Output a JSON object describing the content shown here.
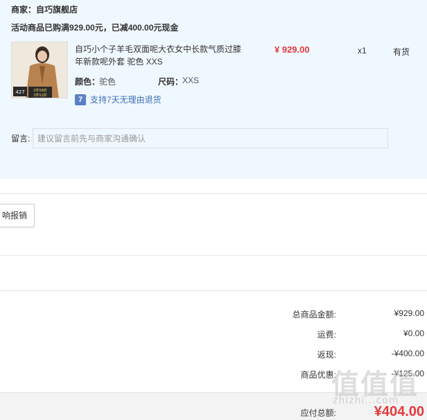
{
  "order": {
    "merchant_line": "商家：自巧旗舰店",
    "promo_line": "活动商品已购满929.00元，已减400.00元现金",
    "product": {
      "title": "自巧小个子羊毛双面呢大衣女中长款气质过膝年新款呢外套 驼色 XXS",
      "price": "¥ 929.00",
      "quantity": "x1",
      "stock": "有货",
      "color_label": "颜色：",
      "color_value": "驼色",
      "size_label": "尺码：",
      "size_value": "XXS",
      "return_icon": "return-badge-icon",
      "return_icon_glyph": "7",
      "return_policy": "支持7天无理由退货",
      "thumbnail_badge": "427",
      "thumbnail_lines": [
        "2件58折",
        "3件52折"
      ]
    },
    "note": {
      "label": "留言:",
      "placeholder": "建议留言前先与商家沟通确认"
    }
  },
  "receipt": {
    "button_label": "响报销"
  },
  "summary": {
    "rows": [
      {
        "label": "总商品金额:",
        "value": "¥929.00"
      },
      {
        "label": "运费:",
        "value": "¥0.00"
      },
      {
        "label": "返现:",
        "value": "-¥400.00"
      },
      {
        "label": "商品优惠:",
        "value": "-¥125.00"
      }
    ],
    "total_label": "应付总额:",
    "total_value": "¥404.00"
  },
  "watermark": {
    "glyphs": "值值值",
    "url": "zhizhi...com"
  },
  "colors": {
    "price_red": "#e4393c",
    "panel_bg": "#f0f8ff",
    "link_blue": "#3b6fb6"
  }
}
